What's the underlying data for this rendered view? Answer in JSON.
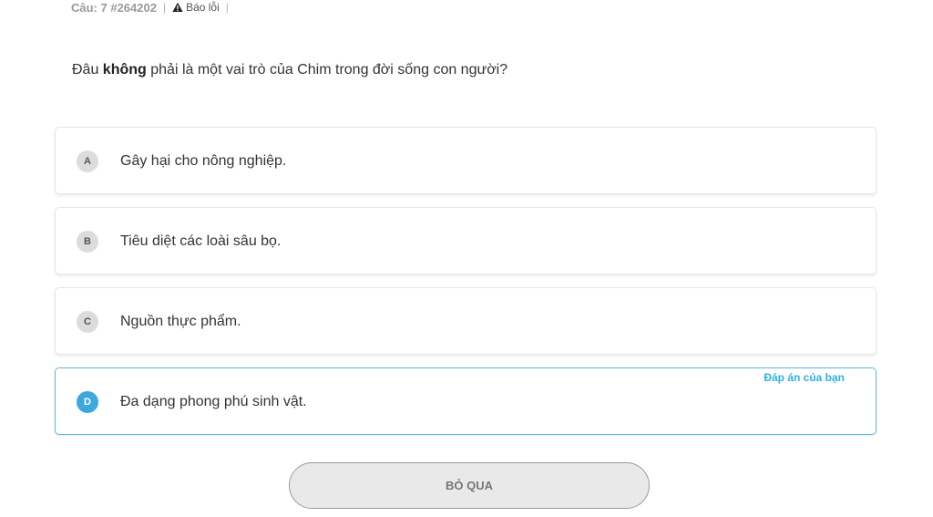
{
  "meta": {
    "question_number": "Câu: 7 #264202",
    "separator": "|",
    "report_label": "Báo lỗi",
    "report_icon": "warning-icon"
  },
  "question": {
    "prefix": "Đâu ",
    "emphasis": "không",
    "suffix": " phải là một vai trò của Chim trong đời sống con người?"
  },
  "options": [
    {
      "letter": "A",
      "text": "Gây hại cho nông nghiệp.",
      "selected": false
    },
    {
      "letter": "B",
      "text": "Tiêu diệt các loài sâu bọ.",
      "selected": false
    },
    {
      "letter": "C",
      "text": "Nguồn thực phẩm.",
      "selected": false
    },
    {
      "letter": "D",
      "text": "Đa dạng phong phú sinh vật.",
      "selected": true
    }
  ],
  "your_answer_label": "Đáp án của bạn",
  "skip_label": "BỎ QUA",
  "colors": {
    "accent": "#3ea8dd",
    "your_answer": "#2fb0e3",
    "badge_default": "#dcdcdc"
  }
}
